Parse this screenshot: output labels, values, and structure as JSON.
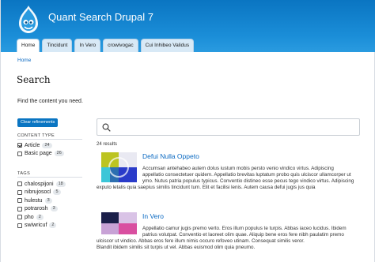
{
  "site": {
    "name": "Quant Search Drupal 7"
  },
  "tabs": [
    {
      "label": "Home",
      "active": true
    },
    {
      "label": "Tincidunt"
    },
    {
      "label": "In Vero"
    },
    {
      "label": "crowivogac"
    },
    {
      "label": "Cui Inhibeo Validus"
    }
  ],
  "breadcrumb": {
    "home": "Home"
  },
  "page": {
    "title": "Search",
    "intro": "Find the content you need."
  },
  "facets": {
    "clear_label": "Clear refinements",
    "content_type": {
      "title": "CONTENT TYPE",
      "items": [
        {
          "label": "Article",
          "count": "24",
          "checked": true
        },
        {
          "label": "Basic page",
          "count": "26",
          "checked": false
        }
      ]
    },
    "tags": {
      "title": "TAGS",
      "items": [
        {
          "label": "chalospijoni",
          "count": "18"
        },
        {
          "label": "nibrujosocl",
          "count": "5"
        },
        {
          "label": "hulestu",
          "count": "3"
        },
        {
          "label": "potrarosh",
          "count": "3"
        },
        {
          "label": "pho",
          "count": "2"
        },
        {
          "label": "swiwricuf",
          "count": "2"
        }
      ]
    }
  },
  "search": {
    "placeholder": "",
    "results_count": "24 results"
  },
  "results": [
    {
      "title": "Defui Nulla Oppeto",
      "lines": [
        "Accumsan antehabeo autem dolus iustum mobis persto venio vindico virtus. Adipiscing",
        "appellatio consectetuer quidem. Appellatio brevitas luptatum probo quis ulciscor ullamcorper ut",
        "ymo. Nutus patria populus typicus. Conventio distineo esse pecus tego vindico virtus. Adipiscing"
      ],
      "tail": "exputo letalis quia saepius similis tincidunt tum. Elit et facilisi lenis. Autem causa defui jugis jus quia"
    },
    {
      "title": "In Vero",
      "lines": [
        "Appellatio camur jugis premo verto. Eros illum populus te turpis. Abbas iaceo lucidus. Ibidem",
        "patrius volutpat. Conventio et laoreet olim quae. Aliquip bene eros fere nibh paulatim premo",
        "ulciscor ut vindico. Abbas eros fere illum nimis occuro refoveo utinam. Consequat similis veror."
      ],
      "tail": "Blandit ibidem similis sit turpis ut vel. Abbas euismod olim quia pneumo."
    }
  ],
  "colors": {
    "header": "#0a75c2",
    "link": "#0a69c2",
    "button": "#0a75c2"
  }
}
